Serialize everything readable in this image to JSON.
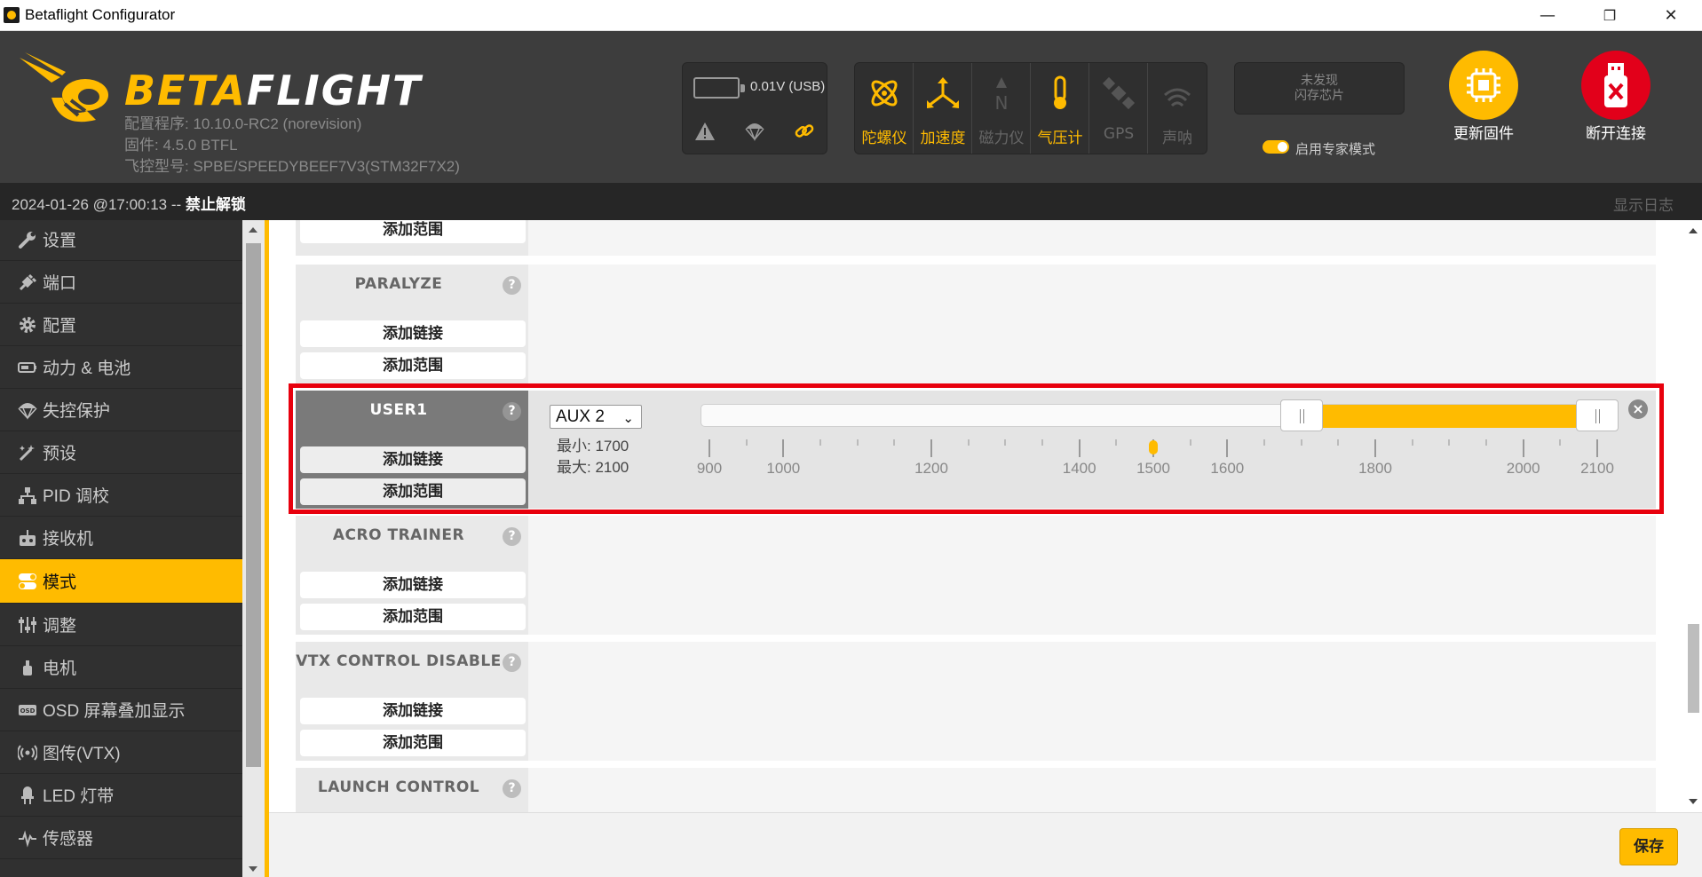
{
  "window": {
    "title": "Betaflight Configurator",
    "minimize_label": "—",
    "restore_label": "❐",
    "close_label": "✕"
  },
  "header": {
    "logo_part1": "BETA",
    "logo_part2": "FLIGHT",
    "configurator_version": "配置程序: 10.10.0-RC2 (norevision)",
    "firmware": "固件: 4.5.0 BTFL",
    "board": "飞控型号: SPBE/SPEEDYBEEF7V3(STM32F7X2)",
    "battery": "0.01V (USB)",
    "sensors": [
      {
        "label": "陀螺仪",
        "icon": "gyro-icon",
        "active": true
      },
      {
        "label": "加速度",
        "icon": "accel-icon",
        "active": true
      },
      {
        "label": "磁力仪",
        "icon": "mag-icon",
        "active": false
      },
      {
        "label": "气压计",
        "icon": "baro-icon",
        "active": true
      },
      {
        "label": "GPS",
        "icon": "gps-icon",
        "active": false
      },
      {
        "label": "声呐",
        "icon": "sonar-icon",
        "active": false
      }
    ],
    "flash_line1": "未发现",
    "flash_line2": "闪存芯片",
    "expert_mode_label": "启用专家模式",
    "update_firmware_label": "更新固件",
    "disconnect_label": "断开连接"
  },
  "status": {
    "datetime": "2024-01-26 @17:00:13 -- ",
    "arming": "禁止解锁",
    "show_log": "显示日志"
  },
  "sidebar": {
    "items": [
      {
        "label": "设置",
        "icon": "wrench-icon"
      },
      {
        "label": "端口",
        "icon": "plug-icon"
      },
      {
        "label": "配置",
        "icon": "gear-icon"
      },
      {
        "label": "动力 & 电池",
        "icon": "battery-icon"
      },
      {
        "label": "失控保护",
        "icon": "parachute-icon"
      },
      {
        "label": "预设",
        "icon": "presets-icon"
      },
      {
        "label": "PID 调校",
        "icon": "pid-icon"
      },
      {
        "label": "接收机",
        "icon": "receiver-icon"
      },
      {
        "label": "模式",
        "icon": "toggle-icon",
        "active": true
      },
      {
        "label": "调整",
        "icon": "sliders-icon"
      },
      {
        "label": "电机",
        "icon": "motor-icon"
      },
      {
        "label": "OSD 屏幕叠加显示",
        "icon": "osd-icon"
      },
      {
        "label": "图传(VTX)",
        "icon": "vtx-icon"
      },
      {
        "label": "LED 灯带",
        "icon": "led-icon"
      },
      {
        "label": "传感器",
        "icon": "sensor-icon"
      }
    ]
  },
  "modes": {
    "add_link": "添加链接",
    "add_range": "添加范围",
    "help": "?",
    "paralyze": "PARALYZE",
    "user1": "USER1",
    "acro_trainer": "ACRO TRAINER",
    "vtx_control_disable": "VTX CONTROL DISABLE",
    "launch_control": "LAUNCH CONTROL",
    "user1_range": {
      "channel": "AUX 2",
      "min_label": "最小: 1700",
      "max_label": "最大: 2100",
      "min": 1700,
      "max": 2100,
      "current": 1500,
      "scale_min": 900,
      "scale_max": 2100,
      "tick_labels": [
        "900",
        "1000",
        "1200",
        "1400",
        "1500",
        "1600",
        "1800",
        "2000",
        "2100"
      ],
      "remove": "×"
    }
  },
  "footer": {
    "save_label": "保存"
  },
  "colors": {
    "accent": "#ffbb00",
    "highlight": "#e8000d",
    "disconnect": "#e2001a"
  }
}
